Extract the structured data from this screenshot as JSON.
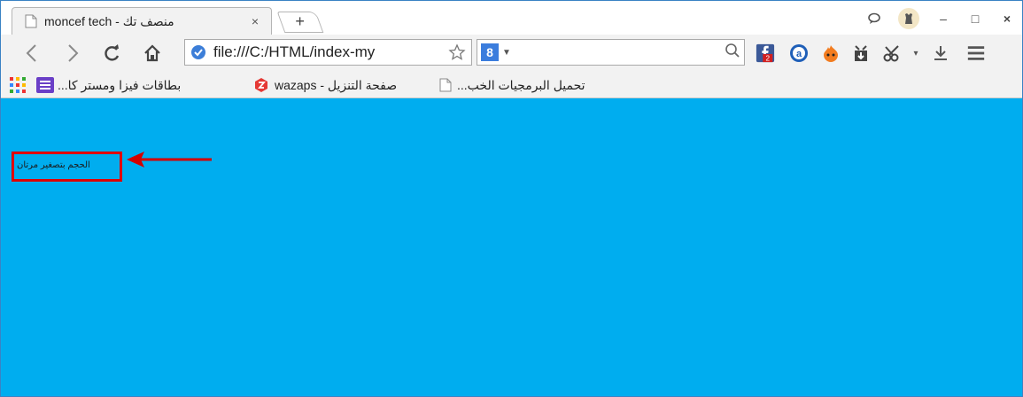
{
  "tab": {
    "title": "moncef tech - منصف تك",
    "close": "×"
  },
  "newtab": {
    "label": "+"
  },
  "window": {
    "minimize": "–",
    "maximize": "□",
    "close": "×"
  },
  "nav": {
    "back": "‹",
    "forward": "›"
  },
  "omnibox": {
    "url": "file:///C:/HTML/index-my"
  },
  "search": {
    "engine_badge": "8",
    "placeholder": ""
  },
  "extensions": {
    "facebook_badge": "2"
  },
  "bookmarks": [
    {
      "label": "بطاقات فيزا ومستر كا..."
    },
    {
      "label": "wazaps - صفحة التنزيل"
    },
    {
      "label": "تحميل البرمجيات الخب..."
    }
  ],
  "page": {
    "text": "الحجم بتصغير مرتان"
  },
  "colors": {
    "page_background": "#00adef",
    "highlight": "#e00000",
    "titlebar_border": "#3a82c4"
  },
  "icons": [
    "page-icon",
    "back-icon",
    "forward-icon",
    "reload-icon",
    "home-icon",
    "secure-icon",
    "star-icon",
    "search-icon",
    "facebook-icon",
    "avast-icon",
    "hola-icon",
    "download-ext-icon",
    "scissors-icon",
    "download-icon",
    "menu-icon",
    "apps-icon",
    "list-icon"
  ]
}
